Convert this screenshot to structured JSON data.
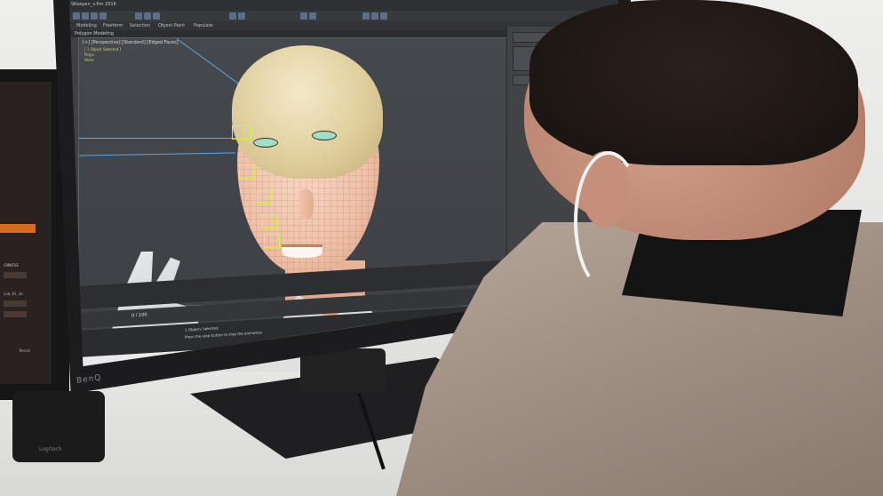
{
  "scene": {
    "description_free": true
  },
  "left_monitor": {
    "labels": [
      "CNMNTHE",
      "zum_01_ob",
      "Reset"
    ]
  },
  "main_monitor": {
    "brand": "BenQ",
    "app": {
      "doc_title": "SKoepen_v.flm 2016",
      "ribbon_tabs": [
        "Modeling",
        "Freeform",
        "Selection",
        "Object Paint",
        "Populate"
      ],
      "subribbon": "Polygon Modeling",
      "viewport_label": "[+] [Perspective] [Standard] [Edged Faces]",
      "viewport_info": [
        "[ 1 Object Selected ]",
        "Polys:",
        "Verts:"
      ],
      "frame_counter": "0 / 100",
      "status_lines": [
        "1 Objects Selected",
        "Press the stop button to stop the animation"
      ]
    }
  },
  "speaker": {
    "logo": "Logitech"
  },
  "colors": {
    "accent_orange": "#d96a1e",
    "control_rig": "#d6f04a",
    "guide_lines": "#5fa8e6",
    "viewport_bg": "#45484d"
  }
}
